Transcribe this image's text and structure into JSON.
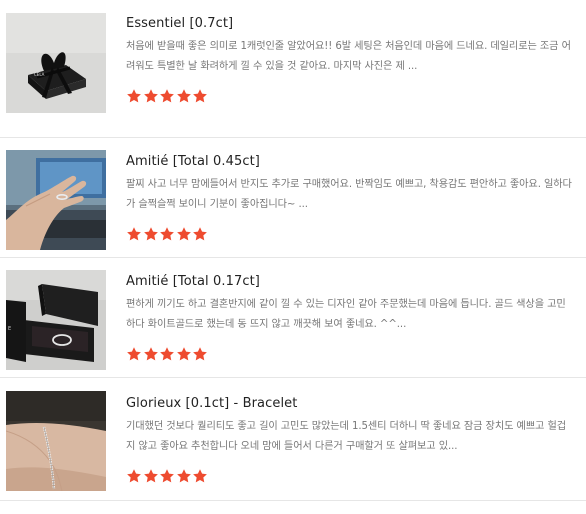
{
  "theme": {
    "star_color": "#ee4b2f"
  },
  "reviews": [
    {
      "title": "Essentiel [0.7ct]",
      "body": "처음에 받을때 좋은 의미로 1캐럿인줄 알았어요!! 6발 세팅은 처음인데 마음에 드네요. 데일리로는 조금 어려워도 특별한 날 화려하게 낄 수 있을 것 같아요. 마지막 사진은 제 ...",
      "rating": 5,
      "thumbnail_icon": "gift-box-with-ribbon-photo"
    },
    {
      "title": "Amitié [Total 0.45ct]",
      "body": "팔찌 사고 너무 맘에들어서 반지도 추가로 구매했어요. 반짝임도 예쁘고, 착용감도 편안하고 좋아요. 일하다가 슬쩍슬쩍 보이니 기분이 좋아집니다~ ...",
      "rating": 5,
      "thumbnail_icon": "hand-wearing-ring-photo"
    },
    {
      "title": "Amitié [Total 0.17ct]",
      "body": "편하게 끼기도 하고 결혼반지에 같이 낄 수 있는 디자인 같아 주문했는데 마음에 듭니다. 골드 색상을 고민하다 화이트골드로 했는데 동 뜨지 않고 깨끗해 보여 좋네요. ^^...",
      "rating": 5,
      "thumbnail_icon": "ring-in-box-photo"
    },
    {
      "title": "Glorieux [0.1ct] - Bracelet",
      "body": "기대했던 것보다 퀄리티도 좋고 길이 고민도 많았는데 1.5센티 더하니 딱 좋네요 잠금 장치도 예쁘고 헐겁지 않고 좋아요 추천합니다 오네 맘에 들어서 다른거 구매할거 또 살펴보고 있...",
      "rating": 5,
      "thumbnail_icon": "wrist-with-bracelet-photo"
    }
  ]
}
